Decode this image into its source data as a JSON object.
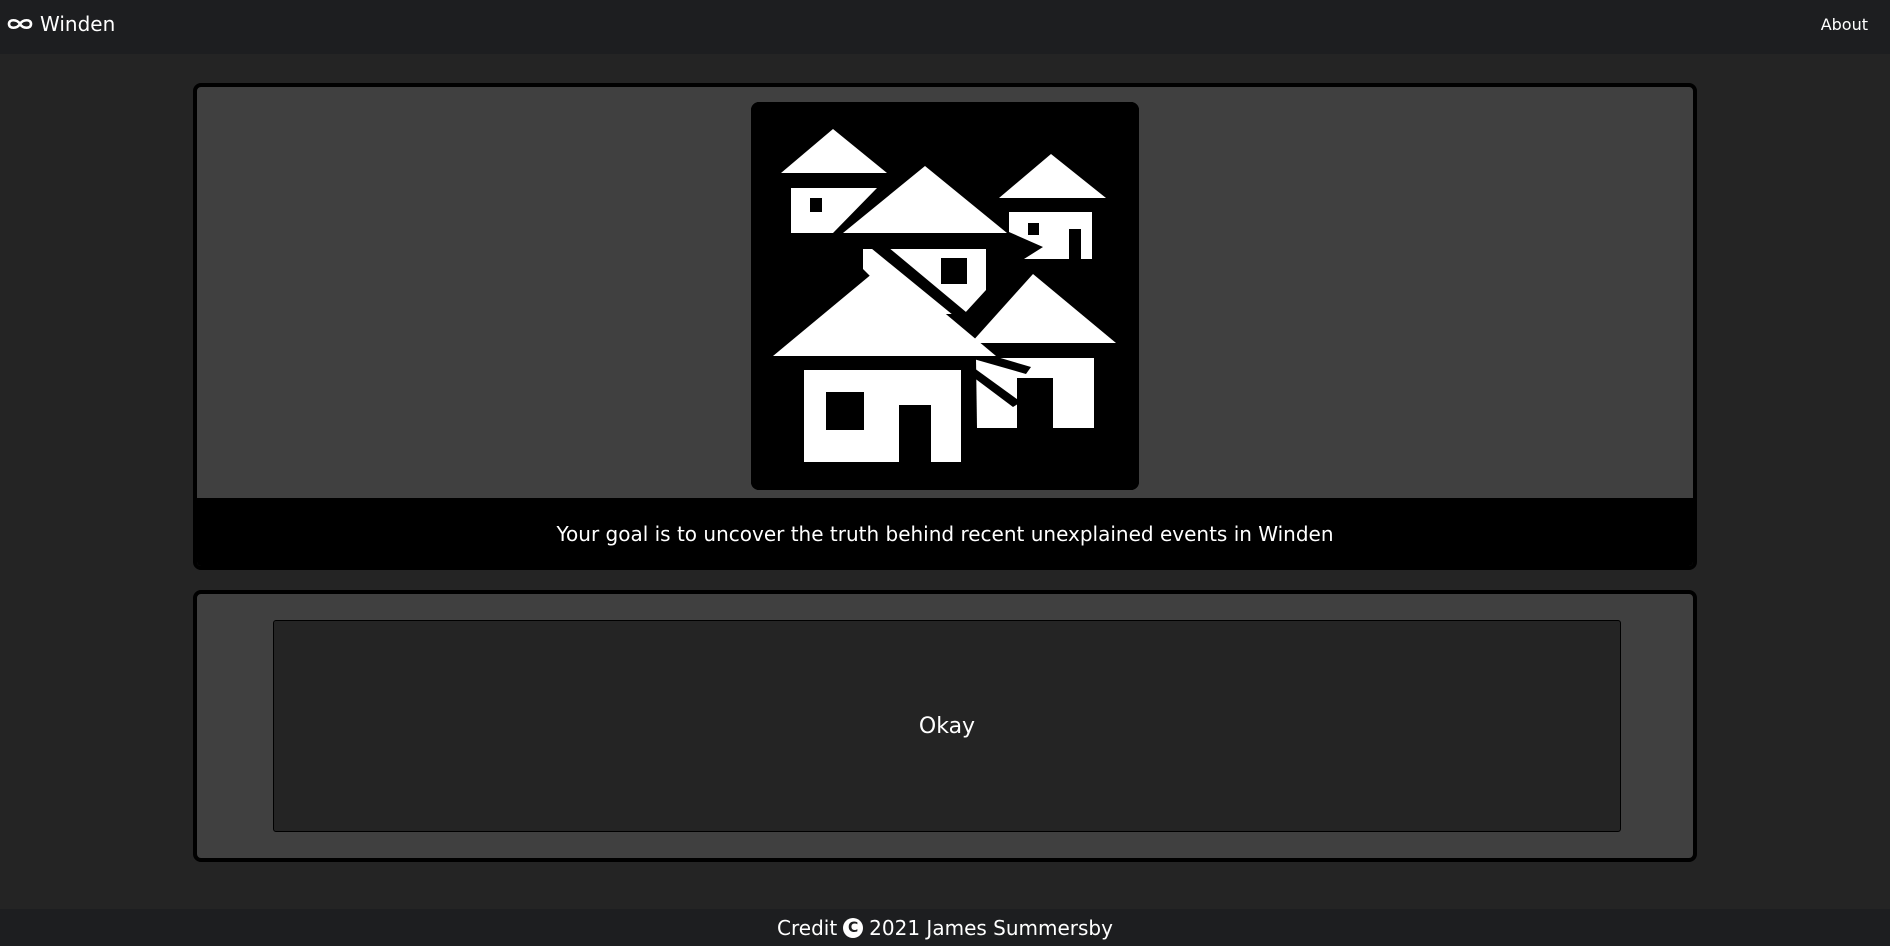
{
  "navbar": {
    "brand_icon": "infinity-icon",
    "brand_label": "Winden",
    "about_label": "About"
  },
  "story": {
    "image_icon": "village-houses-icon",
    "caption": "Your goal is to uncover the truth behind recent unexplained events in Winden"
  },
  "choices": {
    "okay_label": "Okay"
  },
  "footer": {
    "credit_label": "Credit",
    "copyright_symbol": "C",
    "credit_text": "2021 James Summersby"
  },
  "colors": {
    "page_background": "#242424",
    "navbar_background": "#1d1e20",
    "card_background": "#404040",
    "card_border": "#000000",
    "text": "#ffffff"
  }
}
